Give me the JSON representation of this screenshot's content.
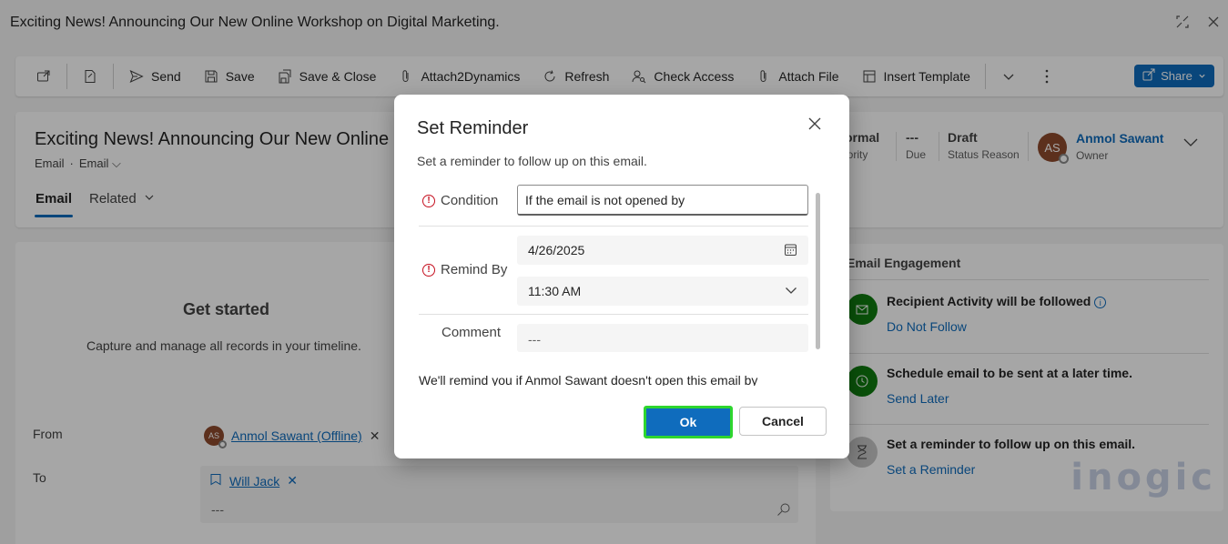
{
  "window": {
    "title": "Exciting News! Announcing Our New Online Workshop on Digital Marketing."
  },
  "commandbar": {
    "send": "Send",
    "save": "Save",
    "save_close": "Save & Close",
    "attach2dynamics": "Attach2Dynamics",
    "refresh": "Refresh",
    "check_access": "Check Access",
    "attach_file": "Attach File",
    "insert_template": "Insert Template",
    "share": "Share"
  },
  "record": {
    "title": "Exciting News! Announcing Our New Online",
    "entity": "Email",
    "form": "Email",
    "tabs": {
      "email": "Email",
      "related": "Related"
    },
    "priority_value": "ormal",
    "priority_label": "iority",
    "due_value": "---",
    "due_label": "Due",
    "status_value": "Draft",
    "status_label": "Status Reason",
    "owner_initials": "AS",
    "owner_name": "Anmol Sawant",
    "owner_label": "Owner"
  },
  "main": {
    "get_started": "Get started",
    "capture": "Capture and manage all records in your timeline.",
    "from_label": "From",
    "from_initials": "AS",
    "from_value": "Anmol Sawant (Offline)",
    "to_label": "To",
    "to_value": "Will Jack",
    "to_empty": "---"
  },
  "engagement": {
    "title": "Email Engagement",
    "items": [
      {
        "heading": "Recipient Activity will be followed",
        "action": "Do Not Follow"
      },
      {
        "heading": "Schedule email to be sent at a later time.",
        "action": "Send Later"
      },
      {
        "heading": "Set a reminder to follow up on this email.",
        "action": "Set a Reminder"
      }
    ],
    "watermark": "inogic"
  },
  "dialog": {
    "title": "Set Reminder",
    "description": "Set a reminder to follow up on this email.",
    "condition_label": "Condition",
    "condition_value": "If the email is not opened by",
    "remind_by_label": "Remind By",
    "date_value": "4/26/2025",
    "time_value": "11:30 AM",
    "comment_label": "Comment",
    "comment_value": "---",
    "note": "We'll remind you if Anmol Sawant doesn't open this email by",
    "ok": "Ok",
    "cancel": "Cancel"
  },
  "colors": {
    "brand": "#0f6cbd",
    "ok_highlight": "#2ed62e",
    "required": "#c50f1f",
    "avatar": "#8e4b2d",
    "engagement_green": "#107c10",
    "engagement_gray": "#c7c7c7"
  }
}
